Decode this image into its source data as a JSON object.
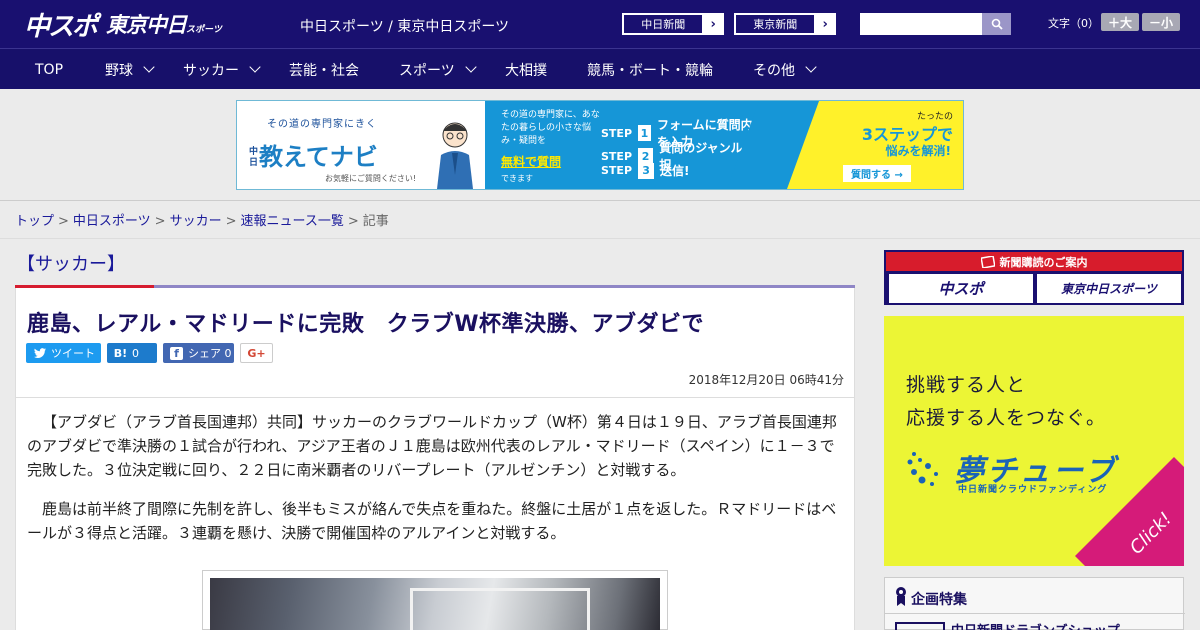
{
  "header": {
    "logo_main": "中スポ",
    "logo_tokyo": "東京中日",
    "logo_tokyo_small": "スポーツ",
    "site_name": "中日スポーツ / 東京中日スポーツ",
    "paper_buttons": [
      "中日新聞",
      "東京新聞"
    ],
    "search_placeholder": "",
    "font_size_label": "文字（0）",
    "font_bigger": "＋大",
    "font_smaller": "－小"
  },
  "nav": {
    "items": [
      {
        "label": "TOP",
        "dropdown": false
      },
      {
        "label": "野球",
        "dropdown": true
      },
      {
        "label": "サッカー",
        "dropdown": true
      },
      {
        "label": "芸能・社会",
        "dropdown": false
      },
      {
        "label": "スポーツ",
        "dropdown": true
      },
      {
        "label": "大相撲",
        "dropdown": false
      },
      {
        "label": "競馬・ボート・競輪",
        "dropdown": false
      },
      {
        "label": "その他",
        "dropdown": true
      }
    ]
  },
  "banner": {
    "left_top": "その道の専門家にきく",
    "left_brand_small": "中日",
    "left_brand": "教えてナビ",
    "left_note": "お気軽にご質問ください!",
    "mid_text": "その道の専門家に、あなたの暮らしの小さな悩み・疑問を",
    "mid_highlight": "無料で質問",
    "mid_tail": "できます",
    "steps": [
      {
        "label": "STEP",
        "num": "1",
        "text": "フォームに質問内容を入力"
      },
      {
        "label": "STEP",
        "num": "2",
        "text": "質問のジャンルを選択"
      },
      {
        "label": "STEP",
        "num": "3",
        "text": "送信!"
      }
    ],
    "right_top": "たったの",
    "right_big": "3ステップで",
    "right_mid": "悩みを解消!",
    "right_cta": "質問する →"
  },
  "breadcrumb": {
    "links": [
      "トップ",
      "中日スポーツ",
      "サッカー",
      "速報ニュース一覧"
    ],
    "current": "記事",
    "sep": ">"
  },
  "article": {
    "category": "【サッカー】",
    "title": "鹿島、レアル・マドリードに完敗　クラブW杯準決勝、アブダビで",
    "share": {
      "tweet": "ツイート",
      "hatena_count": "0",
      "facebook": "シェア",
      "facebook_count": "0",
      "gplus": "G+"
    },
    "date": "2018年12月20日 06時41分",
    "paragraphs": [
      "【アブダビ（アラブ首長国連邦）共同】サッカーのクラブワールドカップ（W杯）第４日は１９日、アラブ首長国連邦のアブダビで準決勝の１試合が行われ、アジア王者のＪ１鹿島は欧州代表のレアル・マドリード（スペイン）に１－３で完敗した。３位決定戦に回り、２２日に南米覇者のリバープレート（アルゼンチン）と対戦する。",
      "鹿島は前半終了間際に先制を許し、後半もミスが絡んで失点を重ねた。終盤に土居が１点を返した。Ｒマドリードはベールが３得点と活躍。３連覇を懸け、決勝で開催国枠のアルアインと対戦する。"
    ]
  },
  "sidebar": {
    "subscribe_title": "新聞購読のご案内",
    "subscribe_buttons": [
      "中スポ",
      "東京中日スポーツ"
    ],
    "ad_lines": [
      "挑戦する人と",
      "応援する人をつなぐ。"
    ],
    "ad_logo": "夢チューブ",
    "ad_sub": "中日新聞クラウドファンディング",
    "ad_click": "Click!",
    "feature_title": "企画特集",
    "feature_item": "中日新聞ドラゴンズショップ"
  },
  "colors": {
    "header_bg": "#191070",
    "accent_red": "#d61c2f",
    "link": "#1a1a9a"
  }
}
